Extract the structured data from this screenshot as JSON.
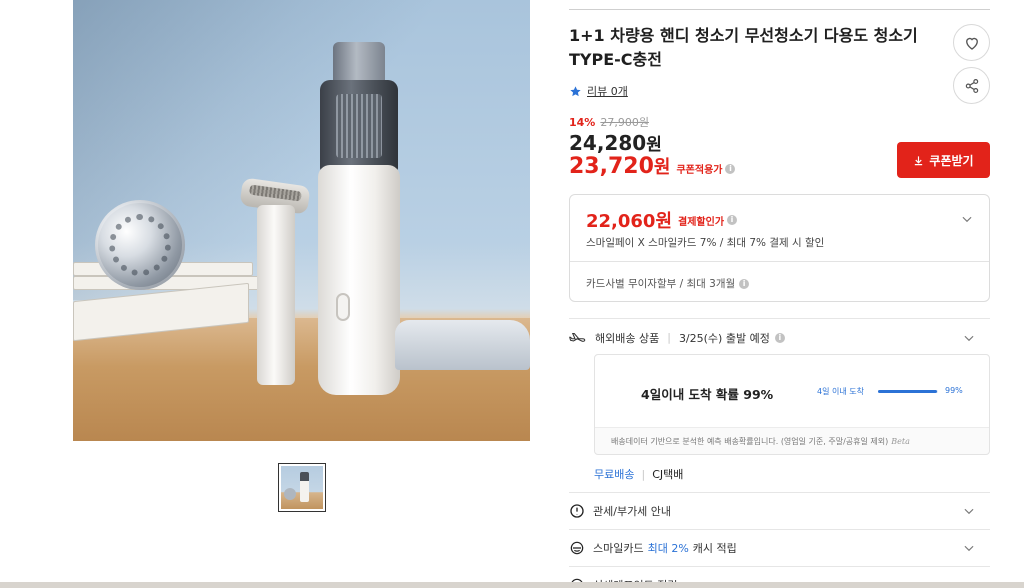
{
  "gallery": {
    "main_image_alt": "handheld vacuum cleaner product photo",
    "thumbnail_count": 1
  },
  "product": {
    "title": "1+1 차량용 핸디 청소기 무선청소기 다용도 청소기 TYPE-C충전",
    "review_label": "리뷰 0개",
    "discount_percent": "14%",
    "original_price": "27,900원",
    "sale_price": "24,280",
    "sale_unit": "원",
    "coupon_price": "23,720",
    "coupon_unit": "원",
    "coupon_note": "쿠폰적용가",
    "coupon_button": "쿠폰받기"
  },
  "payment": {
    "price": "22,060원",
    "note": "결제할인가",
    "description": "스마일페이 X 스마일카드 7% / 최대 7% 결제 시 할인",
    "installment": "카드사별 무이자할부 / 최대 3개월"
  },
  "shipping": {
    "label": "해외배송 상품",
    "departure": "3/25(수) 출발 예정",
    "probability_headline": "4일이내 도착 확률 99%",
    "probability_label": "4일 이내 도착",
    "probability_percent": "99%",
    "probability_value": 0.99,
    "footnote": "배송데이터 기반으로 분석한 예측 배송확률입니다. (영업일 기준, 주말/공휴일 제외)",
    "beta": "Beta",
    "free_label": "무료배송",
    "carrier": "CJ택배"
  },
  "rows": {
    "customs": "관세/부가세 안내",
    "smile_prefix": "스마일카드",
    "smile_highlight": "최대 2%",
    "smile_suffix": "캐시 적립",
    "point": "신세계포인트 적립"
  },
  "colors": {
    "accent_red": "#e2231a",
    "accent_blue": "#2b72d6"
  },
  "icons": {
    "heart": "heart-icon",
    "share": "share-icon",
    "star": "star-icon",
    "download": "download-icon",
    "plane": "plane-icon",
    "alert": "alert-circle-icon",
    "card": "card-icon",
    "chevron": "chevron-down-icon"
  }
}
